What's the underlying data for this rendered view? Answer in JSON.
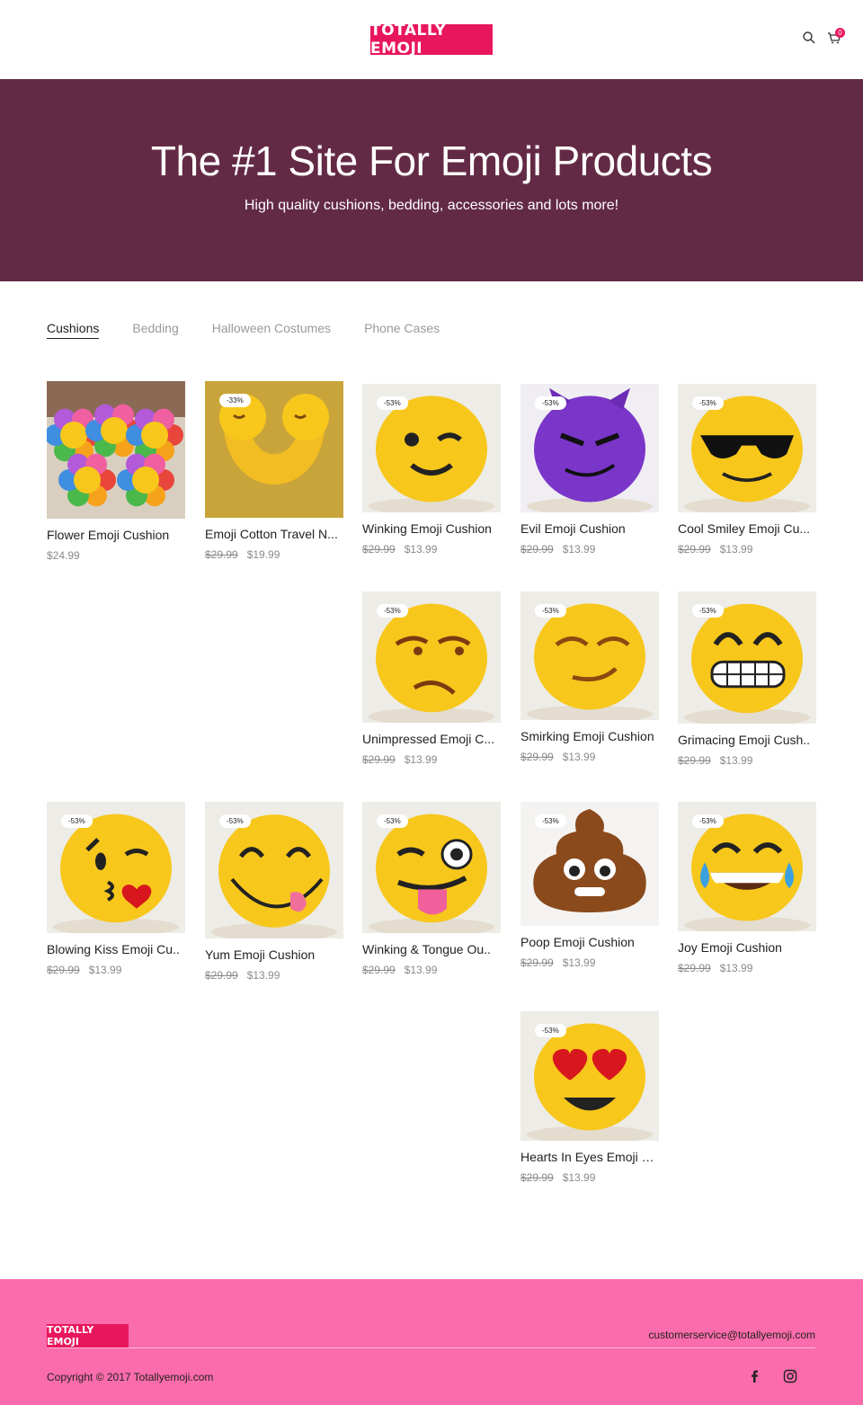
{
  "header": {
    "logo_text": "TOTALLY EMOJI",
    "search_icon": "search-icon",
    "cart_icon": "cart-icon",
    "cart_count": "0"
  },
  "hero": {
    "title": "The #1 Site For Emoji Products",
    "subtitle": "High quality cushions,  bedding, accessories and lots more!"
  },
  "tabs": [
    "Cushions",
    "Bedding",
    "Halloween Costumes",
    "Phone Cases"
  ],
  "products": [
    {
      "name": "Flower Emoji Cushion",
      "old_price": "",
      "price": "$24.99",
      "discount": "",
      "image": "flower"
    },
    {
      "name": "Emoji Cotton Travel N...",
      "old_price": "$29.99",
      "price": "$19.99",
      "discount": "-33%",
      "image": "travel"
    },
    {
      "name": "Winking Emoji Cushion",
      "old_price": "$29.99",
      "price": "$13.99",
      "discount": "-53%",
      "image": "wink"
    },
    {
      "name": "Evil Emoji Cushion",
      "old_price": "$29.99",
      "price": "$13.99",
      "discount": "-53%",
      "image": "evil"
    },
    {
      "name": "Cool Smiley Emoji Cu...",
      "old_price": "$29.99",
      "price": "$13.99",
      "discount": "-53%",
      "image": "cool"
    },
    {
      "name": "Unimpressed Emoji C...",
      "old_price": "$29.99",
      "price": "$13.99",
      "discount": "-53%",
      "image": "unimpressed"
    },
    {
      "name": "Smirking Emoji Cushion",
      "old_price": "$29.99",
      "price": "$13.99",
      "discount": "-53%",
      "image": "smirk"
    },
    {
      "name": "Grimacing Emoji Cush..",
      "old_price": "$29.99",
      "price": "$13.99",
      "discount": "-53%",
      "image": "grimace"
    },
    {
      "name": "Blowing Kiss Emoji Cu..",
      "old_price": "$29.99",
      "price": "$13.99",
      "discount": "-53%",
      "image": "kiss"
    },
    {
      "name": "Yum Emoji Cushion",
      "old_price": "$29.99",
      "price": "$13.99",
      "discount": "-53%",
      "image": "yum"
    },
    {
      "name": "Winking & Tongue Ou..",
      "old_price": "$29.99",
      "price": "$13.99",
      "discount": "-53%",
      "image": "tongue"
    },
    {
      "name": "Poop Emoji Cushion",
      "old_price": "$29.99",
      "price": "$13.99",
      "discount": "-53%",
      "image": "poop"
    },
    {
      "name": "Joy Emoji Cushion",
      "old_price": "$29.99",
      "price": "$13.99",
      "discount": "-53%",
      "image": "joy"
    },
    {
      "name": "Hearts In Eyes Emoji C..",
      "old_price": "$29.99",
      "price": "$13.99",
      "discount": "-53%",
      "image": "hearts"
    }
  ],
  "footer": {
    "logo_text": "TOTALLY EMOJI",
    "email": "customerservice@totallyemoji.com",
    "copyright": "Copyright © 2017 Totallyemoji.com",
    "social_icons": [
      "facebook-icon",
      "instagram-icon"
    ]
  },
  "colors": {
    "brand": "#e8175d",
    "hero_bg": "#632a46",
    "footer_bg": "#fa6cab",
    "emoji_yellow": "#f7c71c"
  }
}
